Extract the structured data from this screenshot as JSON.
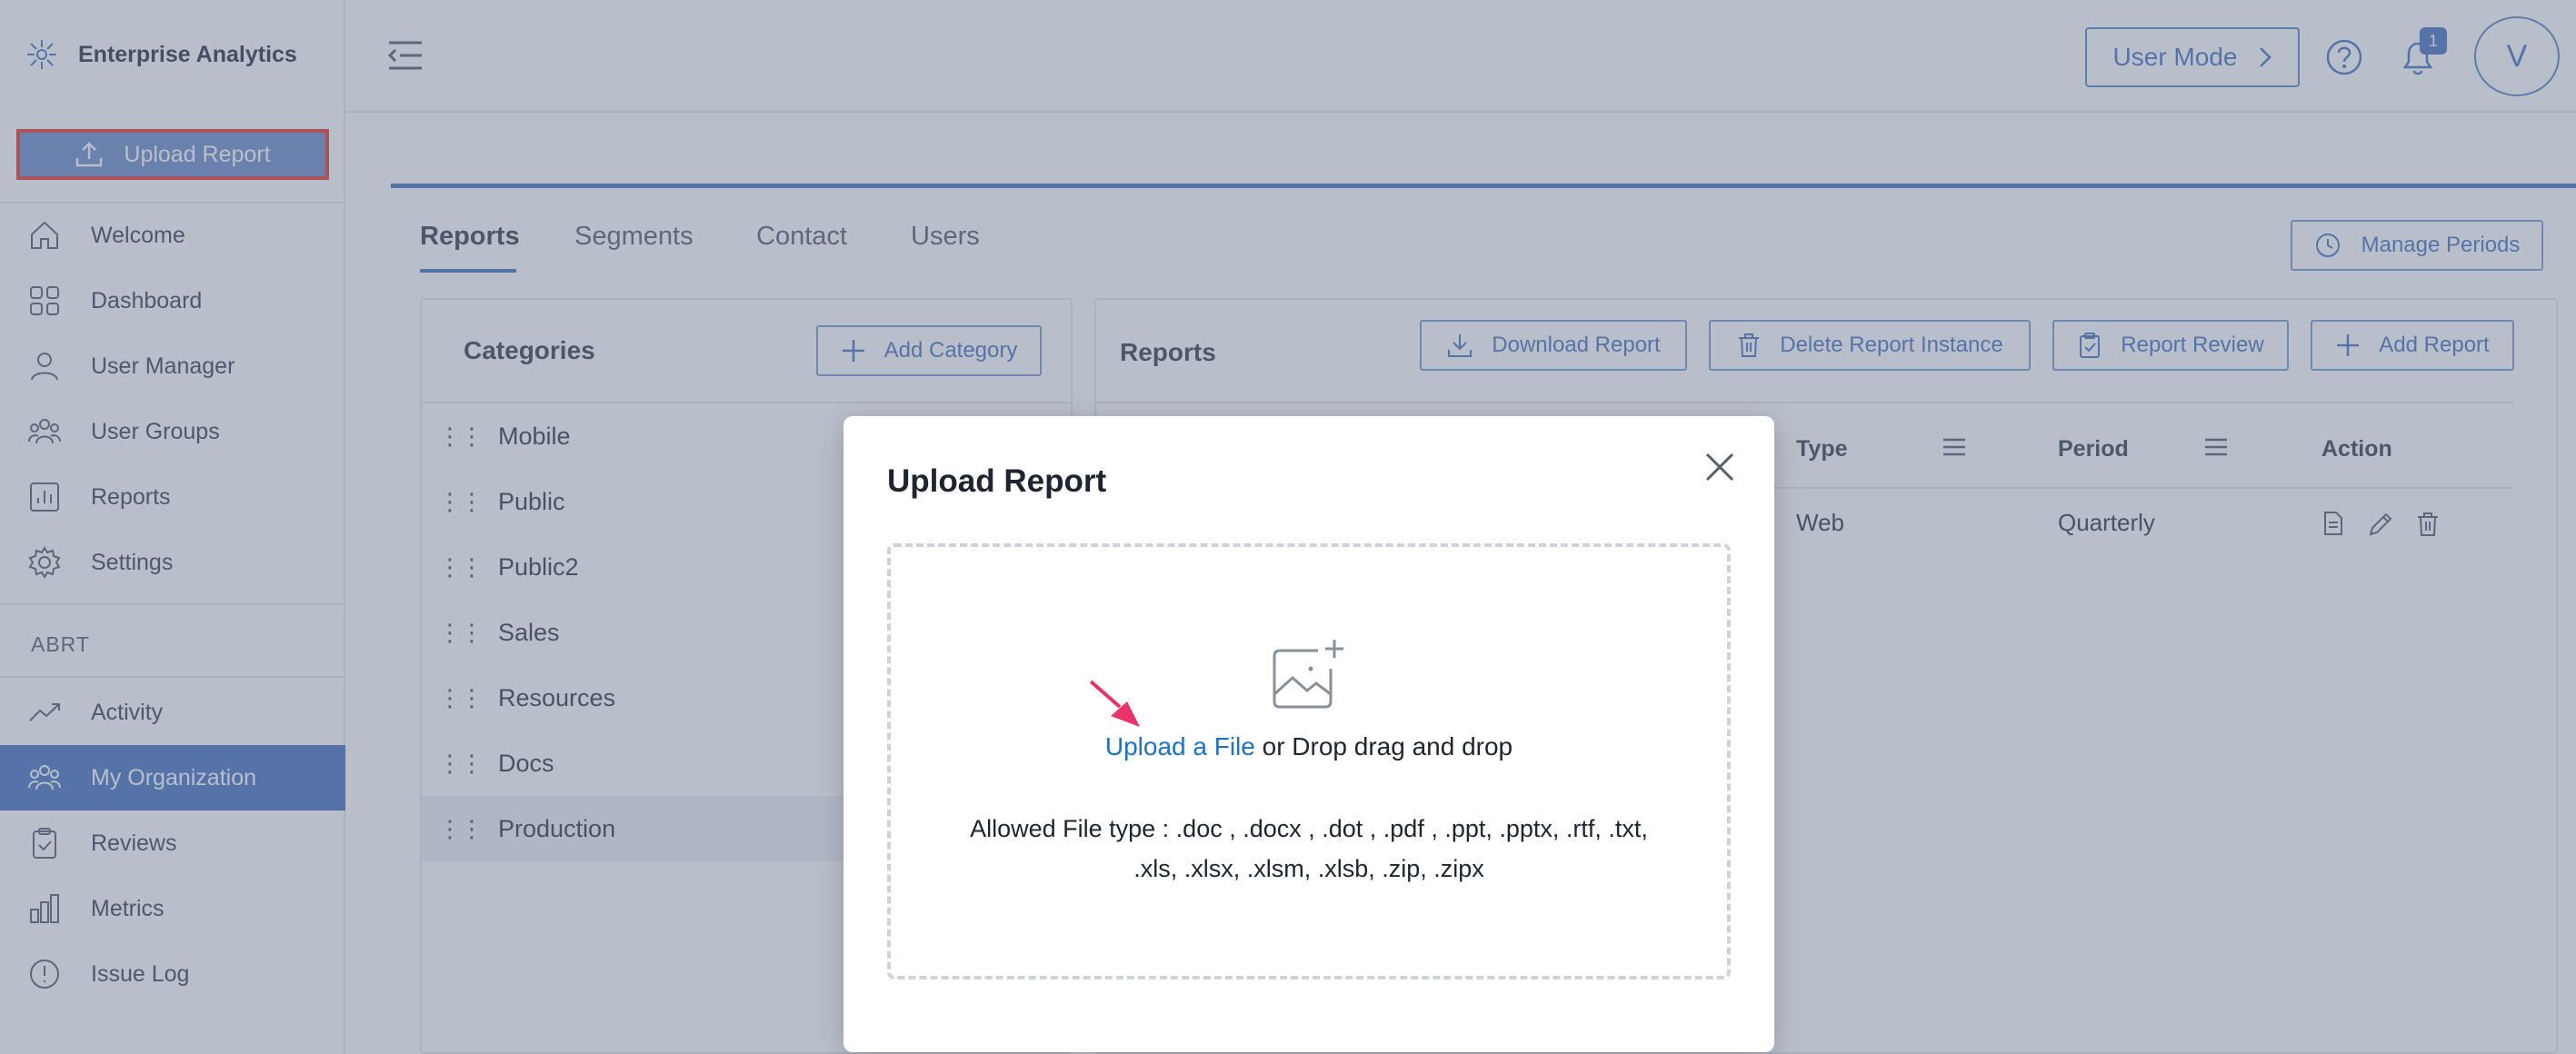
{
  "sidebar": {
    "brand": "Enterprise Analytics",
    "upload_button": "Upload Report",
    "items": [
      {
        "label": "Welcome"
      },
      {
        "label": "Dashboard"
      },
      {
        "label": "User Manager"
      },
      {
        "label": "User Groups"
      },
      {
        "label": "Reports"
      },
      {
        "label": "Settings"
      }
    ],
    "section": "ABRT",
    "items2": [
      {
        "label": "Activity"
      },
      {
        "label": "My Organization"
      },
      {
        "label": "Reviews"
      },
      {
        "label": "Metrics"
      },
      {
        "label": "Issue Log"
      }
    ]
  },
  "topbar": {
    "user_mode": "User Mode",
    "notification_count": "1",
    "avatar_initial": "V"
  },
  "tabs": [
    "Reports",
    "Segments",
    "Contact",
    "Users"
  ],
  "manage_periods": "Manage Periods",
  "categories": {
    "title": "Categories",
    "add_button": "Add Category",
    "items": [
      "Mobile",
      "Public",
      "Public2",
      "Sales",
      "Resources",
      "Docs",
      "Production"
    ]
  },
  "reports": {
    "title": "Reports",
    "buttons": {
      "download": "Download Report",
      "delete": "Delete Report Instance",
      "review": "Report Review",
      "add": "Add Report"
    },
    "columns": {
      "type": "Type",
      "period": "Period",
      "action": "Action"
    },
    "row": {
      "type": "Web",
      "period": "Quarterly"
    }
  },
  "modal": {
    "title": "Upload Report",
    "upload_link": "Upload a File",
    "upload_rest": " or Drop drag and drop",
    "allowed_line1": "Allowed File type : .doc , .docx , .dot , .pdf , .ppt, .pptx, .rtf, .txt,",
    "allowed_line2": ".xls, .xlsx, .xlsm, .xlsb, .zip, .zipx"
  },
  "colors": {
    "accent": "#4a76c2",
    "highlight_border": "#e53935",
    "pointer": "#e8336b",
    "link": "#1a73c9"
  }
}
